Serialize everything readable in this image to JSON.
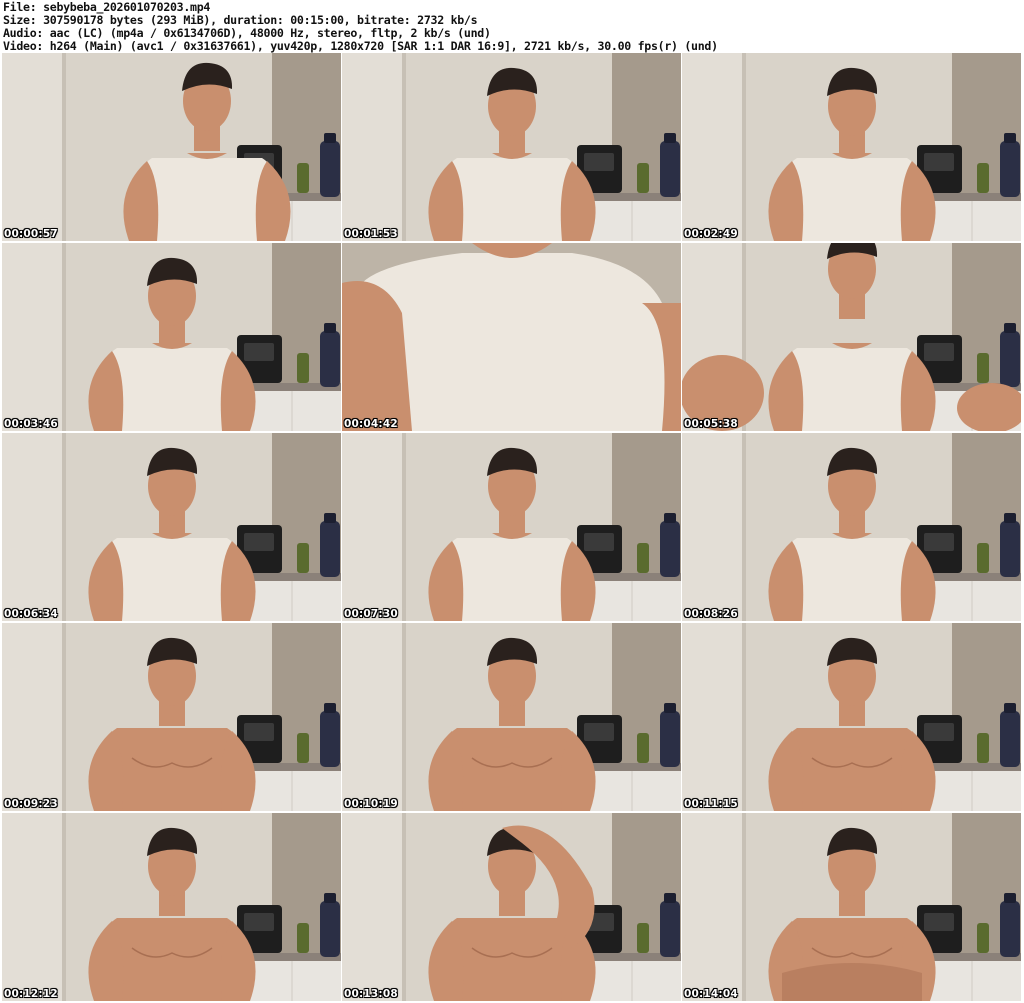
{
  "info": {
    "file": "File: sebybeba_202601070203.mp4",
    "size": "Size: 307590178 bytes (293 MiB), duration: 00:15:00, bitrate: 2732 kb/s",
    "audio": "Audio: aac (LC) (mp4a / 0x6134706D), 48000 Hz, stereo, fltp, 2 kb/s (und)",
    "video": "Video: h264 (Main) (avc1 / 0x31637661), yuv420p, 1280x720 [SAR 1:1 DAR 16:9], 2721 kb/s, 30.00 fps(r) (und)"
  },
  "colors": {
    "wall": "#d9d3c9",
    "wall_dark": "#a59a8c",
    "skin": "#c98f6e",
    "shirt": "#ede7de",
    "hair": "#2a211d",
    "bottle": "#2b2f45",
    "appliance": "#1e1e1e",
    "counter": "#8b8179",
    "cabinet": "#e8e5e0"
  },
  "frames": [
    {
      "timestamp": "00:00:57",
      "shirt": true,
      "variant": "head-tilt"
    },
    {
      "timestamp": "00:01:53",
      "shirt": true,
      "variant": "normal"
    },
    {
      "timestamp": "00:02:49",
      "shirt": true,
      "variant": "normal"
    },
    {
      "timestamp": "00:03:46",
      "shirt": true,
      "variant": "normal"
    },
    {
      "timestamp": "00:04:42",
      "shirt": true,
      "variant": "closeup"
    },
    {
      "timestamp": "00:05:38",
      "shirt": true,
      "variant": "arm-forward"
    },
    {
      "timestamp": "00:06:34",
      "shirt": true,
      "variant": "normal"
    },
    {
      "timestamp": "00:07:30",
      "shirt": true,
      "variant": "normal"
    },
    {
      "timestamp": "00:08:26",
      "shirt": true,
      "variant": "normal"
    },
    {
      "timestamp": "00:09:23",
      "shirt": false,
      "variant": "normal"
    },
    {
      "timestamp": "00:10:19",
      "shirt": false,
      "variant": "normal"
    },
    {
      "timestamp": "00:11:15",
      "shirt": false,
      "variant": "normal"
    },
    {
      "timestamp": "00:12:12",
      "shirt": false,
      "variant": "normal"
    },
    {
      "timestamp": "00:13:08",
      "shirt": false,
      "variant": "hand-head"
    },
    {
      "timestamp": "00:14:04",
      "shirt": false,
      "variant": "arms-crossed"
    }
  ]
}
